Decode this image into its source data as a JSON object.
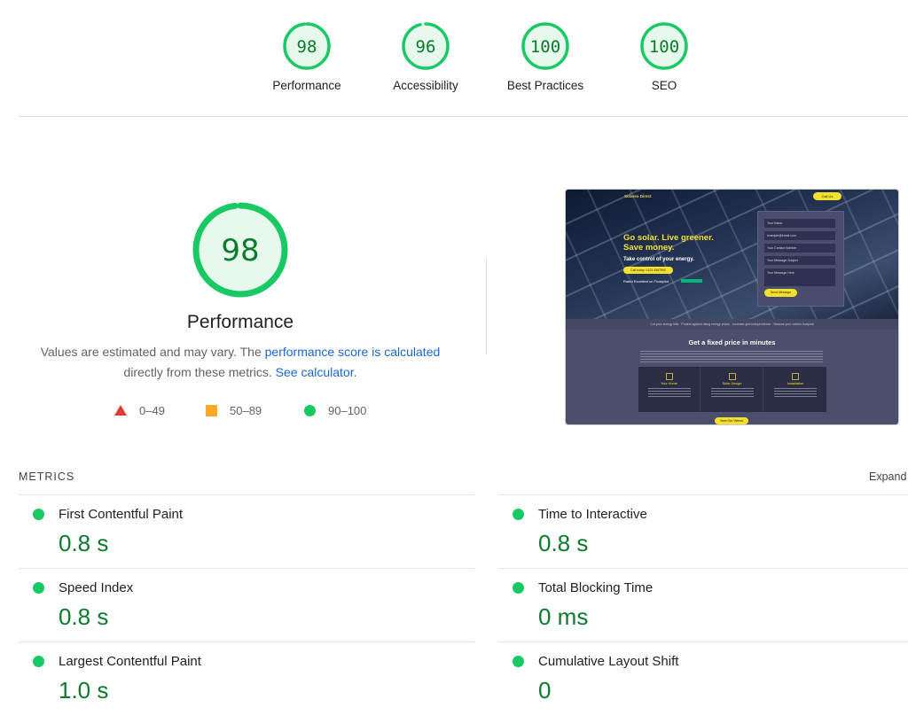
{
  "categories": [
    {
      "score": "98",
      "label": "Performance",
      "fraction": 0.98
    },
    {
      "score": "96",
      "label": "Accessibility",
      "fraction": 0.96
    },
    {
      "score": "100",
      "label": "Best Practices",
      "fraction": 1.0
    },
    {
      "score": "100",
      "label": "SEO",
      "fraction": 1.0
    }
  ],
  "performance": {
    "score": "98",
    "fraction": 0.98,
    "title": "Performance",
    "desc_1": "Values are estimated and may vary. The ",
    "desc_link_1": "performance score is calculated",
    "desc_2": "directly from these metrics. ",
    "desc_link_2": "See calculator",
    "desc_3": ".",
    "legend": {
      "fail": "0–49",
      "average": "50–89",
      "pass": "90–100"
    }
  },
  "preview": {
    "logo": "Solareo Direct",
    "call": "Call Us",
    "headline": "Go solar. Live greener. Save money.",
    "subhead": "Take control of your energy.",
    "cta": "Call today: 0123 4567890",
    "rated": "Rated Excellent on Trustpilot",
    "form_fields": [
      "Your Name",
      "example@email.com",
      "Your Contact Number",
      "Your Message Subject",
      "Your Message Here"
    ],
    "send": "Send Message",
    "strip": "Cut your energy bills · Protect against rising energy prices · Increase grid independence · Reduce your carbon footprint",
    "fixed_title": "Get a fixed price in minutes",
    "cards": [
      "Your Home",
      "Solar Design",
      "Installation"
    ],
    "view_button": "View Our Videos"
  },
  "metrics": {
    "title": "METRICS",
    "expand": "Expand view",
    "items": [
      {
        "name": "First Contentful Paint",
        "value": "0.8 s",
        "status": "pass"
      },
      {
        "name": "Time to Interactive",
        "value": "0.8 s",
        "status": "pass"
      },
      {
        "name": "Speed Index",
        "value": "0.8 s",
        "status": "pass"
      },
      {
        "name": "Total Blocking Time",
        "value": "0 ms",
        "status": "pass"
      },
      {
        "name": "Largest Contentful Paint",
        "value": "1.0 s",
        "status": "pass"
      },
      {
        "name": "Cumulative Layout Shift",
        "value": "0",
        "status": "pass"
      }
    ]
  },
  "colors": {
    "pass": "#0c7b2c",
    "pass_fill": "#18c964",
    "average": "#ffa726",
    "fail": "#e53935",
    "link": "#1967d2"
  }
}
